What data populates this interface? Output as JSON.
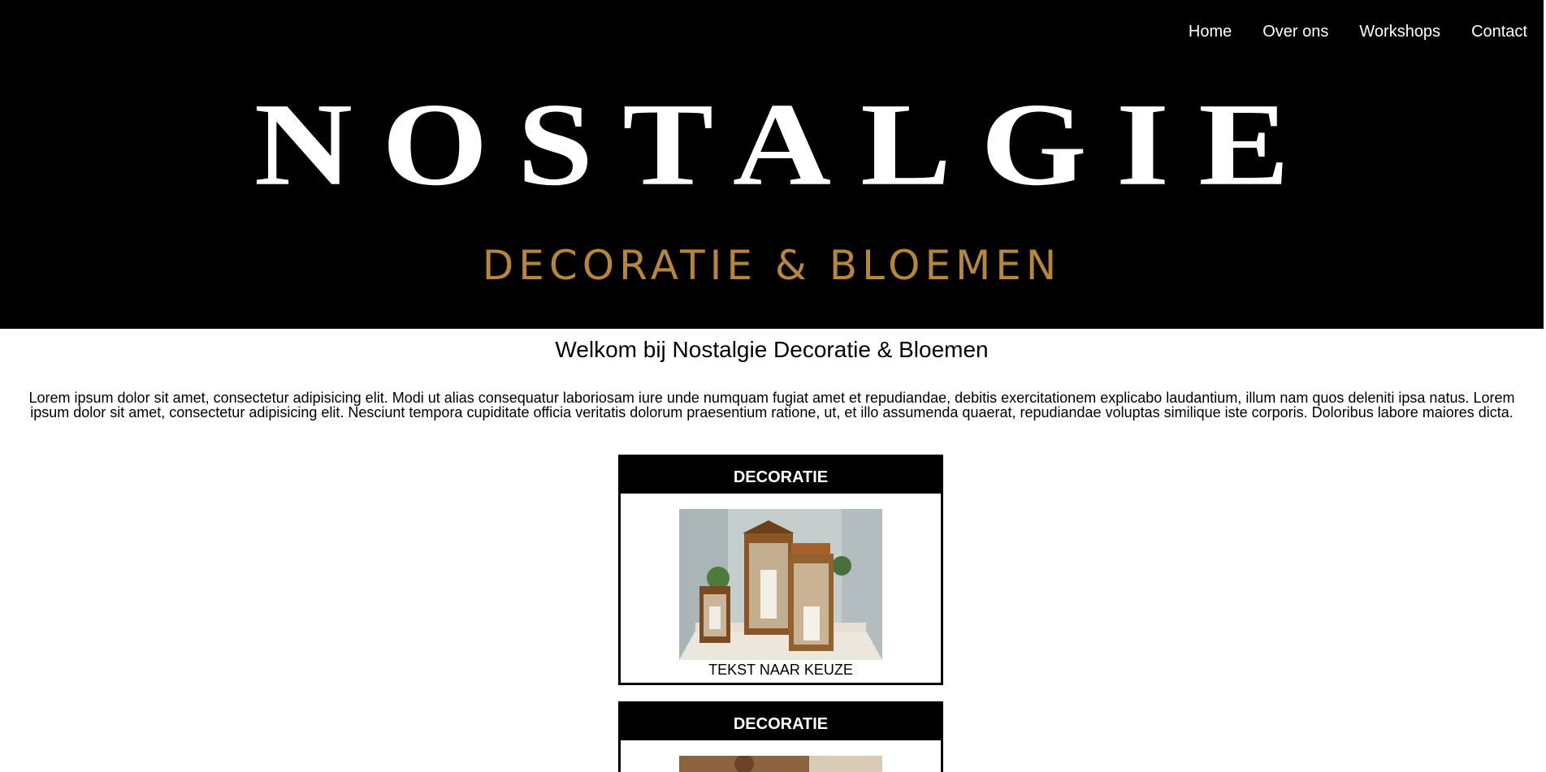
{
  "nav": {
    "items": [
      {
        "label": "Home"
      },
      {
        "label": "Over ons"
      },
      {
        "label": "Workshops"
      },
      {
        "label": "Contact"
      }
    ]
  },
  "logo": {
    "title": "NOSTALGIE",
    "subtitle": "DECORATIE & BLOEMEN",
    "subtitle_color": "#b8863b"
  },
  "main": {
    "heading": "Welkom bij Nostalgie Decoratie & Bloemen",
    "intro": "Lorem ipsum dolor sit amet, consectetur adipisicing elit. Modi ut alias consequatur laboriosam iure unde numquam fugiat amet et repudiandae, debitis exercitationem explicabo laudantium, illum nam quos deleniti ipsa natus. Lorem ipsum dolor sit amet, consectetur adipisicing elit. Nesciunt tempora cupiditate officia veritatis dolorum praesentium ratione, ut, et illo assumenda quaerat, repudiandae voluptas similique iste corporis. Doloribus labore maiores dicta."
  },
  "cards": [
    {
      "title": "DECORATIE",
      "caption": "TEKST NAAR KEUZE"
    },
    {
      "title": "DECORATIE"
    }
  ]
}
